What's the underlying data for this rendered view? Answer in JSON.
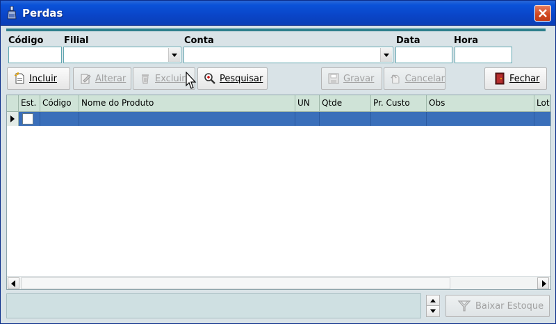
{
  "window": {
    "title": "Perdas"
  },
  "fields": {
    "codigo_label": "Código",
    "filial_label": "Filial",
    "conta_label": "Conta",
    "data_label": "Data",
    "hora_label": "Hora",
    "codigo_value": "",
    "filial_value": "",
    "conta_value": "",
    "data_value": "",
    "hora_value": ""
  },
  "toolbar": {
    "incluir": "Incluir",
    "alterar": "Alterar",
    "excluir": "Excluir",
    "pesquisar": "Pesquisar",
    "gravar": "Gravar",
    "cancelar": "Cancelar",
    "fechar": "Fechar"
  },
  "grid": {
    "columns": [
      "Est.",
      "Código",
      "Nome do Produto",
      "UN",
      "Qtde",
      "Pr. Custo",
      "Obs",
      "Lot"
    ]
  },
  "bottom": {
    "baixar_label": "Baixar Estoque"
  },
  "colors": {
    "titlebar": "#0a52d8",
    "accent": "#2d7f8c",
    "row_selected": "#3a6fba",
    "header": "#cfe3d7"
  }
}
